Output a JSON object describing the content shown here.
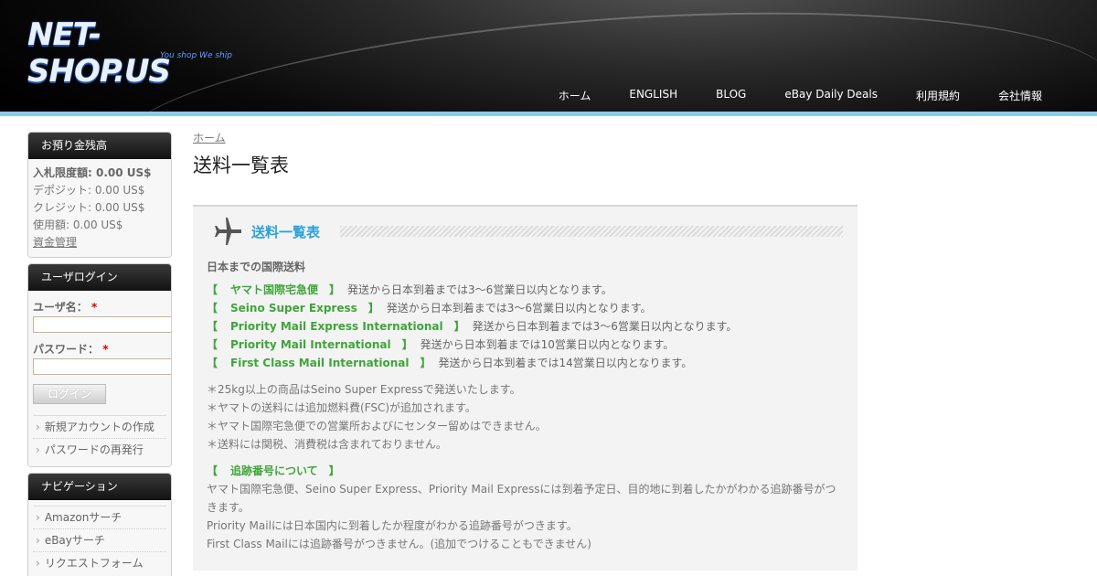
{
  "header": {
    "logo_text": "NET-SHOP.US",
    "logo_tagline": "You shop We ship",
    "nav": [
      "ホーム",
      "ENGLISH",
      "BLOG",
      "eBay Daily Deals",
      "利用規約",
      "会社情報"
    ]
  },
  "balance": {
    "title": "お預り金残高",
    "bid_limit": "入札限度額: 0.00 US$",
    "deposit": "デポジット: 0.00 US$",
    "credit": "クレジット: 0.00 US$",
    "used": "使用額: 0.00 US$",
    "manage_link": "資金管理"
  },
  "login": {
    "title": "ユーザログイン",
    "username_label": "ユーザ名：",
    "password_label": "パスワード：",
    "required_mark": "*",
    "button": "ログイン",
    "links": [
      "新規アカウントの作成",
      "パスワードの再発行"
    ]
  },
  "navigation": {
    "title": "ナビゲーション",
    "items": [
      "Amazonサーチ",
      "eBayサーチ",
      "リクエストフォーム"
    ]
  },
  "main": {
    "breadcrumb": "ホーム",
    "page_title": "送料一覧表",
    "panel_title": "送料一覧表",
    "subtitle": "日本までの国際送料",
    "open_bracket": "【",
    "close_bracket": "】",
    "services": [
      {
        "name": "ヤマト国際宅急便",
        "desc": "発送から日本到着までは3～6営業日以内となります。"
      },
      {
        "name": "Seino Super Express",
        "desc": "発送から日本到着までは3～6営業日以内となります。"
      },
      {
        "name": "Priority Mail Express International",
        "desc": "発送から日本到着までは3～6営業日以内となります。"
      },
      {
        "name": "Priority Mail International",
        "desc": "発送から日本到着までは10営業日以内となります。"
      },
      {
        "name": "First Class Mail International",
        "desc": "発送から日本到着までは14営業日以内となります。"
      }
    ],
    "notes": [
      "＊25kg以上の商品はSeino Super Expressで発送いたします。",
      "＊ヤマトの送料には追加燃料費(FSC)が追加されます。",
      "＊ヤマト国際宅急便での営業所およびにセンター留めはできません。",
      "＊送料には関税、消費税は含まれておりません。"
    ],
    "tracking_title": "追跡番号について",
    "tracking_lines": [
      "ヤマト国際宅急便、Seino Super Express、Priority Mail Expressには到着予定日、目的地に到着したかがわかる追跡番号がつきます。",
      "Priority Mailには日本国内に到着したか程度がわかる追跡番号がつきます。",
      "First Class Mailには追跡番号がつきません。(追加でつけることもできません)"
    ]
  }
}
